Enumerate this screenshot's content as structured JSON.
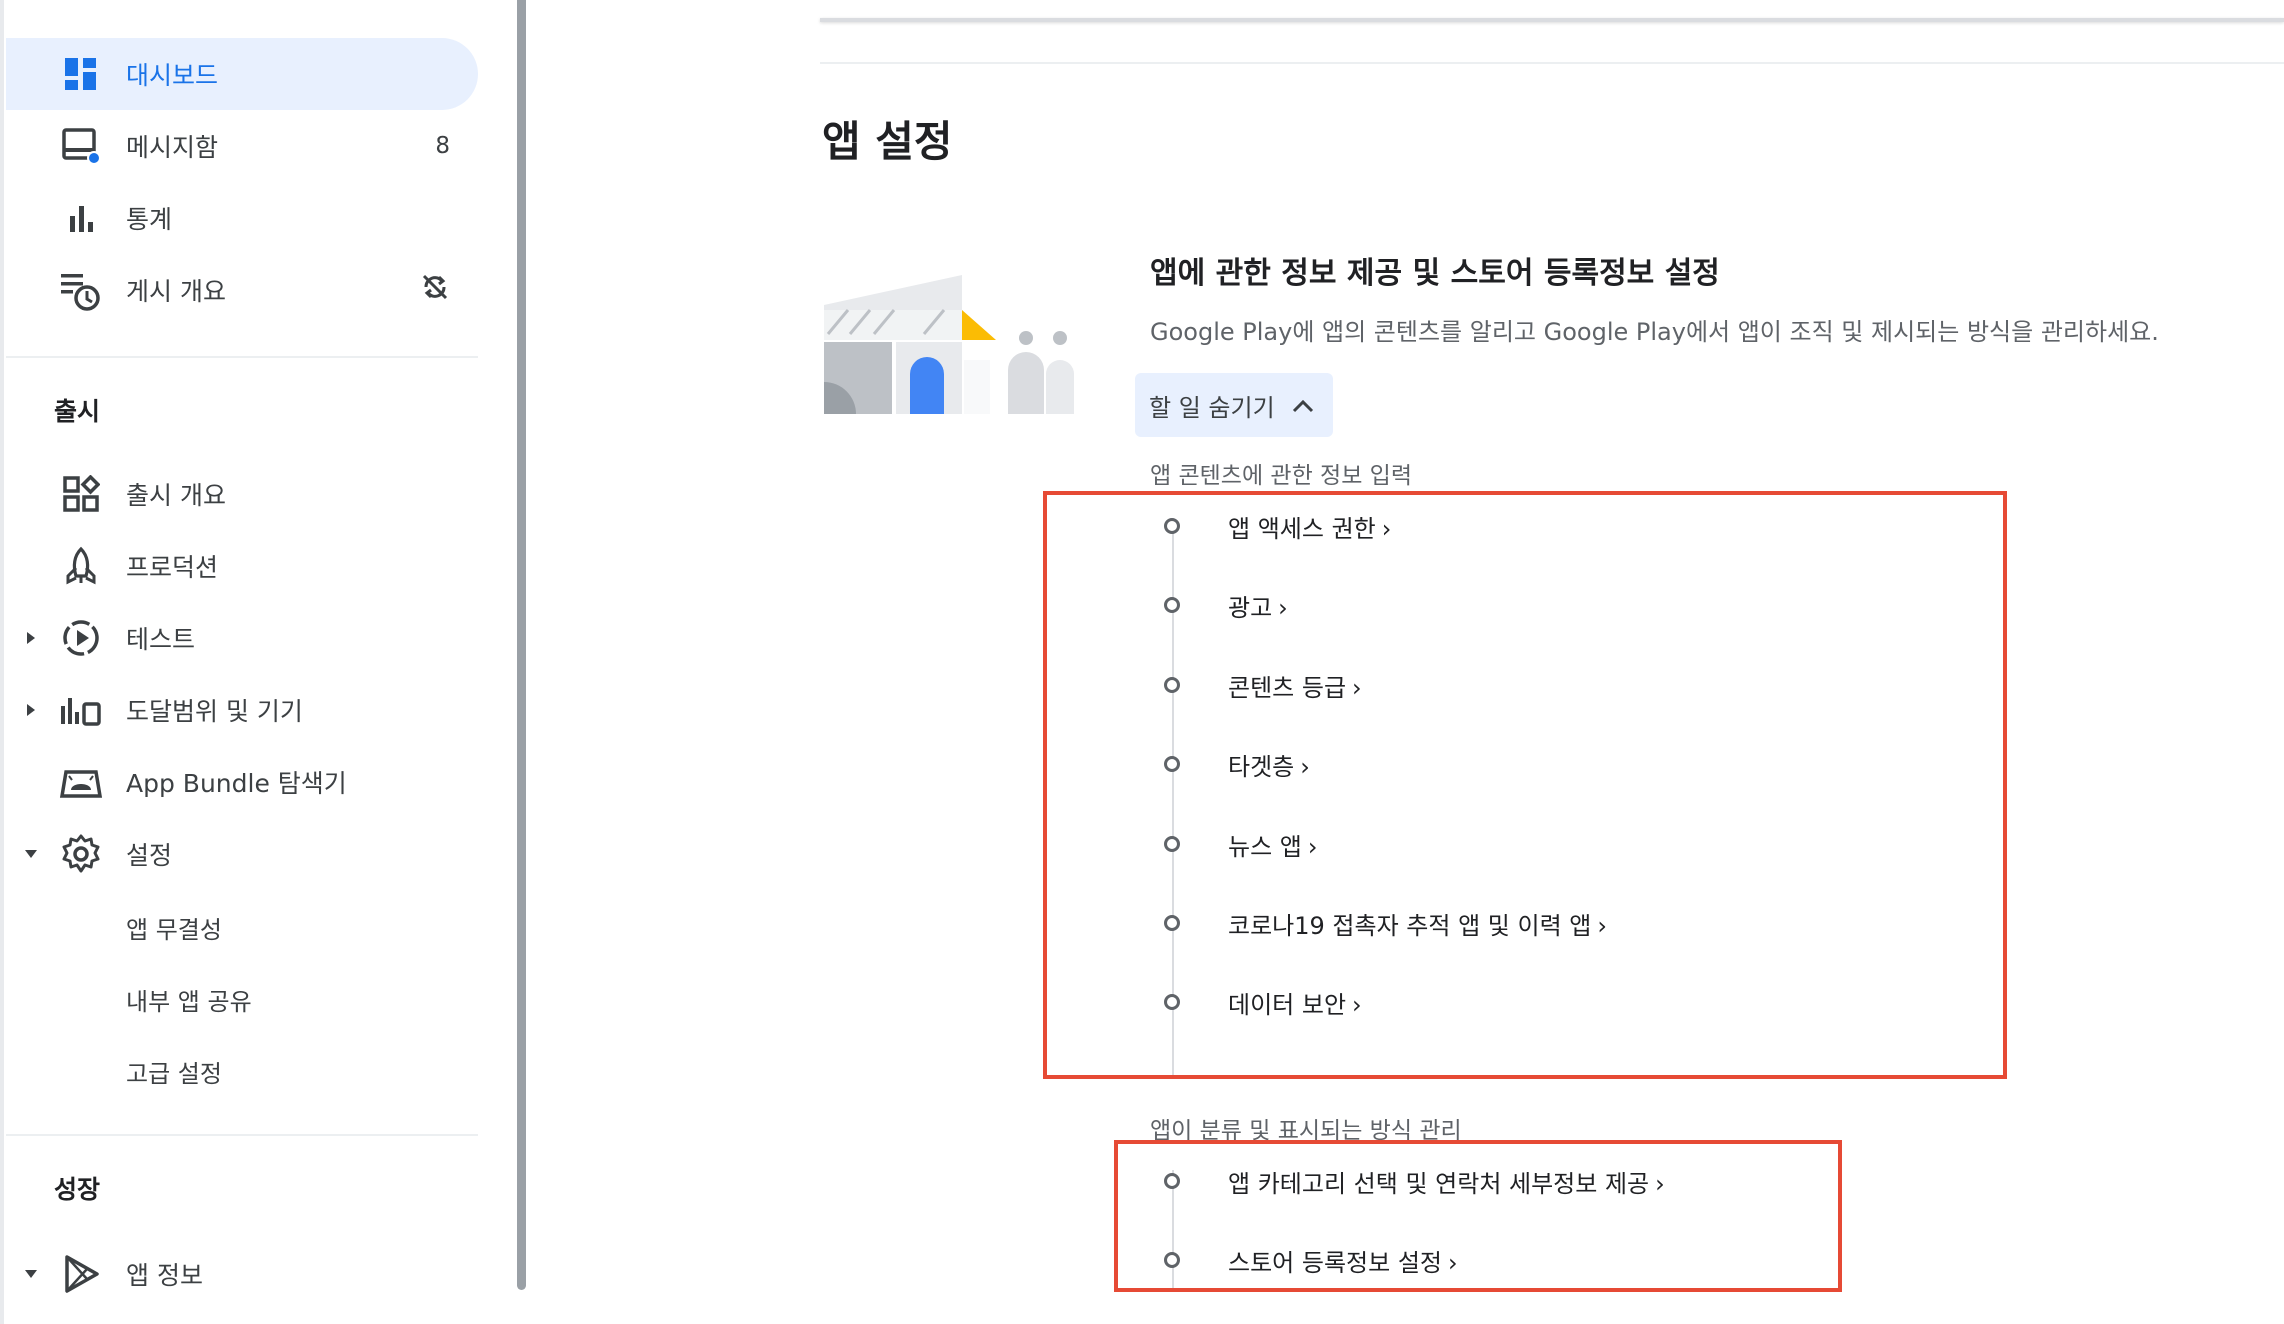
{
  "sidebar": {
    "nav": [
      {
        "label": "대시보드",
        "icon": "dashboard-icon",
        "active": true
      },
      {
        "label": "메시지함",
        "icon": "inbox-icon",
        "badge": "8"
      },
      {
        "label": "통계",
        "icon": "bar-chart-icon"
      },
      {
        "label": "게시 개요",
        "icon": "publishing-overview-icon",
        "right_icon": "sync-disabled-icon"
      }
    ],
    "release_section": {
      "title": "출시",
      "items": [
        {
          "label": "출시 개요",
          "icon": "release-overview-icon"
        },
        {
          "label": "프로덕션",
          "icon": "production-icon"
        },
        {
          "label": "테스트",
          "icon": "test-icon",
          "caret": "right"
        },
        {
          "label": "도달범위 및 기기",
          "icon": "reach-devices-icon",
          "caret": "right"
        },
        {
          "label": "App Bundle 탐색기",
          "icon": "app-bundle-icon"
        },
        {
          "label": "설정",
          "icon": "settings-gear-icon",
          "caret": "down"
        }
      ],
      "sub_items": [
        "앱 무결성",
        "내부 앱 공유",
        "고급 설정"
      ]
    },
    "growth_section": {
      "title": "성장",
      "items": [
        {
          "label": "앱 정보",
          "icon": "play-store-icon",
          "caret": "down"
        }
      ]
    }
  },
  "main": {
    "page_title": "앱 설정",
    "card": {
      "title": "앱에 관한 정보 제공 및 스토어 등록정보 설정",
      "description": "Google Play에 앱의 콘텐츠를 알리고 Google Play에서 앱이 조직 및 제시되는 방식을 관리하세요.",
      "hide_tasks_label": "할 일 숨기기",
      "groups": [
        {
          "label": "앱 콘텐츠에 관한 정보 입력",
          "tasks": [
            "앱 액세스 권한",
            "광고",
            "콘텐츠 등급",
            "타겟층",
            "뉴스 앱",
            "코로나19 접촉자 추적 앱 및 이력 앱",
            "데이터 보안"
          ]
        },
        {
          "label": "앱이 분류 및 표시되는 방식 관리",
          "tasks": [
            "앱 카테고리 선택 및 연락처 세부정보 제공",
            "스토어 등록정보 설정"
          ]
        }
      ],
      "chevron": "›"
    }
  },
  "colors": {
    "accent": "#1a73e8",
    "active_bg": "#e8f0fe",
    "highlight_box": "#e64a35",
    "text_primary": "#202124",
    "text_secondary": "#5f6368"
  }
}
